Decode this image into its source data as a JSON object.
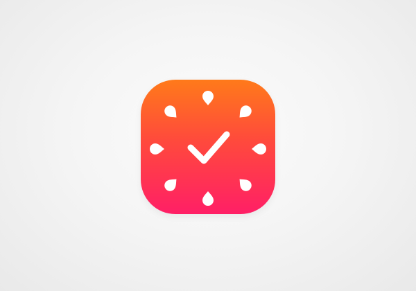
{
  "app_icon": {
    "icon": "clock-checkmark-icon",
    "name": "",
    "colors": {
      "background": "#f5f5f5",
      "gradient_top": "#ff7a1a",
      "gradient_bottom": "#ff1f66",
      "glyph": "#ffffff"
    }
  }
}
